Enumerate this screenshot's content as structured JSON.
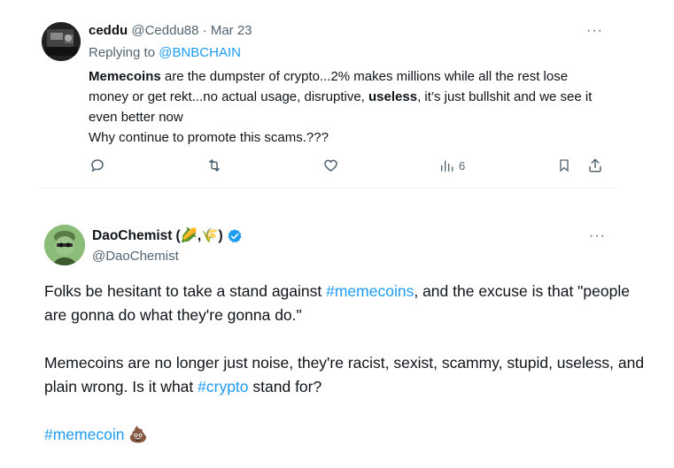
{
  "tweet1": {
    "name": "ceddu",
    "handle": "@Ceddu88",
    "sep": "·",
    "date": "Mar 23",
    "replying_prefix": "Replying to",
    "replying_to": "@BNBCHAIN",
    "bold1": "Memecoins",
    "text1": " are the dumpster of crypto...2% makes millions while all the rest lose money or get rekt...no actual usage, disruptive, ",
    "bold2": "useless",
    "text2": ", it’s just bullshit and we see it even better now",
    "line2": "Why continue to promote this scams.???",
    "views": "6",
    "more": "···"
  },
  "tweet2": {
    "name": "DaoChemist",
    "name_suffix": "(🌽,🌾)",
    "handle": "@DaoChemist",
    "more": "···",
    "p1_pre": "Folks be hesitant to take a stand against ",
    "p1_tag": "#memecoins",
    "p1_post": ", and the excuse is that \"people are gonna do what they're gonna do.\"",
    "p2_pre": "Memecoins are no longer just noise, they're racist, sexist, scammy, stupid, useless, and plain wrong. Is it what ",
    "p2_tag": "#crypto",
    "p2_post": " stand for?",
    "p3_tag": "#memecoin",
    "p3_emoji": "💩"
  },
  "icons": {
    "reply": "reply-icon",
    "retweet": "retweet-icon",
    "like": "like-icon",
    "views": "views-icon",
    "bookmark": "bookmark-icon",
    "share": "share-icon",
    "verified": "verified-badge-icon"
  },
  "colors": {
    "link": "#1d9bf0",
    "muted": "#536471",
    "text": "#0f1419"
  }
}
